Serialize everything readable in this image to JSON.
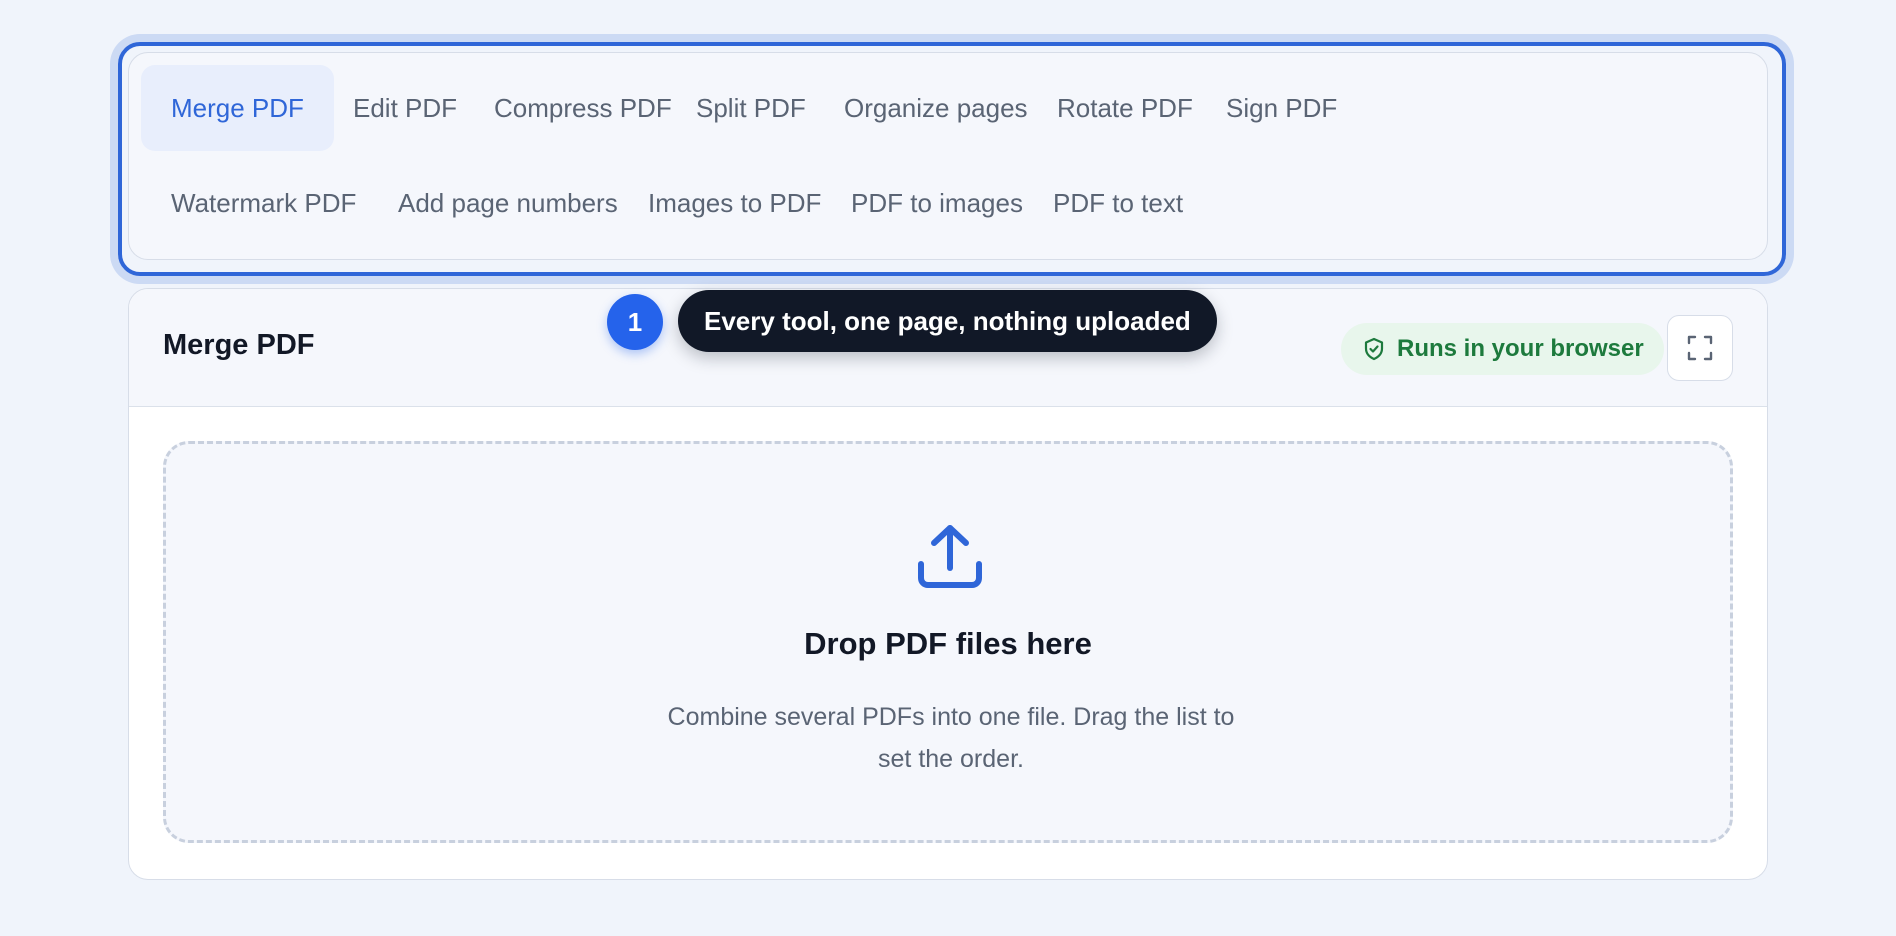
{
  "tools_nav": {
    "tabs": [
      {
        "label": "Merge PDF",
        "active": true
      },
      {
        "label": "Edit PDF",
        "active": false
      },
      {
        "label": "Compress PDF",
        "active": false
      },
      {
        "label": "Split PDF",
        "active": false
      },
      {
        "label": "Organize pages",
        "active": false
      },
      {
        "label": "Rotate PDF",
        "active": false
      },
      {
        "label": "Sign PDF",
        "active": false
      },
      {
        "label": "Watermark PDF",
        "active": false
      },
      {
        "label": "Add page numbers",
        "active": false
      },
      {
        "label": "Images to PDF",
        "active": false
      },
      {
        "label": "PDF to images",
        "active": false
      },
      {
        "label": "PDF to text",
        "active": false
      }
    ]
  },
  "tour": {
    "step_number": "1",
    "tooltip": "Every tool, one page, nothing uploaded"
  },
  "tool_panel": {
    "title": "Merge PDF",
    "badge": {
      "label": "Runs in your browser",
      "icon": "shield-check-icon"
    },
    "fullscreen_icon": "expand-icon"
  },
  "dropzone": {
    "icon": "upload-icon",
    "title": "Drop PDF files here",
    "description": "Combine several PDFs into one file. Drag the list to set the order."
  },
  "colors": {
    "accent": "#2f66d8",
    "badge_bg": "#e8f6ec",
    "badge_text": "#1d7a3d",
    "tooltip_bg": "#111827"
  }
}
